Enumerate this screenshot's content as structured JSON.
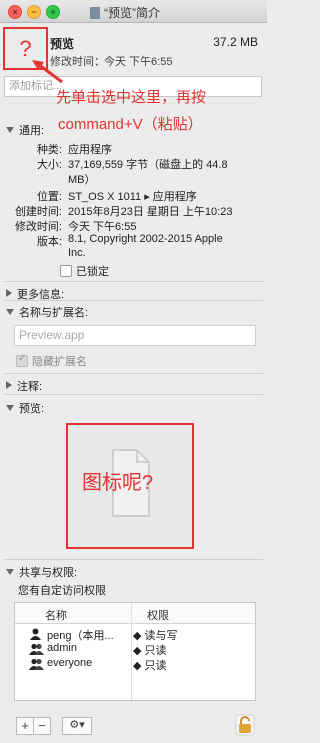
{
  "window": {
    "title": "“预览”简介"
  },
  "header": {
    "icon_placeholder": "?",
    "name": "预览",
    "size": "37.2 MB",
    "modified_label": "修改时间：",
    "modified_value": "今天 下午6:55"
  },
  "tags": {
    "placeholder": "添加标记..."
  },
  "annotation": {
    "line1": "先单击选中这里，再按",
    "line2": "command+V（粘贴）"
  },
  "general": {
    "title": "通用:",
    "rows": [
      {
        "label": "种类:",
        "value": "应用程序"
      },
      {
        "label": "大小:",
        "value": "37,169,559 字节（磁盘上的 44.8"
      },
      {
        "label": "",
        "value": "MB）"
      },
      {
        "label": "位置:",
        "value": "ST_OS X 1011 ▸ 应用程序"
      },
      {
        "label": "创建时间:",
        "value": "2015年8月23日 星期日 上午10:23"
      },
      {
        "label": "修改时间:",
        "value": "今天 下午6:55"
      },
      {
        "label": "版本:",
        "value": "8.1, Copyright 2002-2015 Apple"
      },
      {
        "label": "",
        "value": "Inc."
      }
    ],
    "locked_label": "已锁定"
  },
  "more_info": {
    "title": "更多信息:"
  },
  "name_ext": {
    "title": "名称与扩展名:",
    "field_value": "Preview.app",
    "hide_ext_label": "隐藏扩展名"
  },
  "comments": {
    "title": "注释:"
  },
  "preview": {
    "title": "预览:",
    "annotation": "图标呢?"
  },
  "sharing": {
    "title": "共享与权限:",
    "subtitle": "您有自定访问权限",
    "col_name": "名称",
    "col_priv": "权限",
    "rows": [
      {
        "name": "peng（本用...",
        "priv": "读与写"
      },
      {
        "name": "admin",
        "priv": "只读"
      },
      {
        "name": "everyone",
        "priv": "只读"
      }
    ],
    "add": "+",
    "remove": "−",
    "action": "⚙▾"
  },
  "colors": {
    "annotation": "#e53232"
  }
}
